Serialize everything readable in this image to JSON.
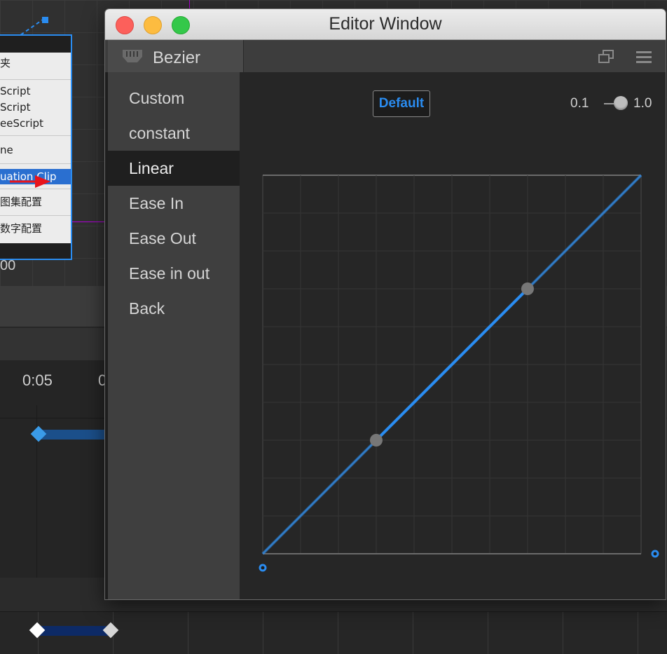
{
  "background": {
    "context_menu": {
      "items": [
        "夹",
        "Script",
        "Script",
        "eeScript",
        "ne",
        "uation Clip",
        "图集配置",
        "数字配置"
      ]
    },
    "coord_label": "00",
    "timeline": {
      "time_label": "0:05",
      "time_label_2": "0"
    }
  },
  "window": {
    "title": "Editor Window",
    "tab_label": "Bezier",
    "presets": [
      "Custom",
      "constant",
      "Linear",
      "Ease In",
      "Ease Out",
      "Ease in out",
      "Back"
    ],
    "selected_preset": "Linear",
    "default_button_label": "Default",
    "slider": {
      "min_label": "0.1",
      "max_label": "1.0",
      "value": 1.0
    },
    "curve": {
      "start": [
        0,
        0
      ],
      "control_point_1": [
        0.3,
        0.3
      ],
      "control_point_2": [
        0.7,
        0.7
      ],
      "end": [
        1,
        1
      ]
    },
    "colors": {
      "accent": "#2a8cf0",
      "curve": "#2a8cf0",
      "control_point": "#777777"
    }
  }
}
